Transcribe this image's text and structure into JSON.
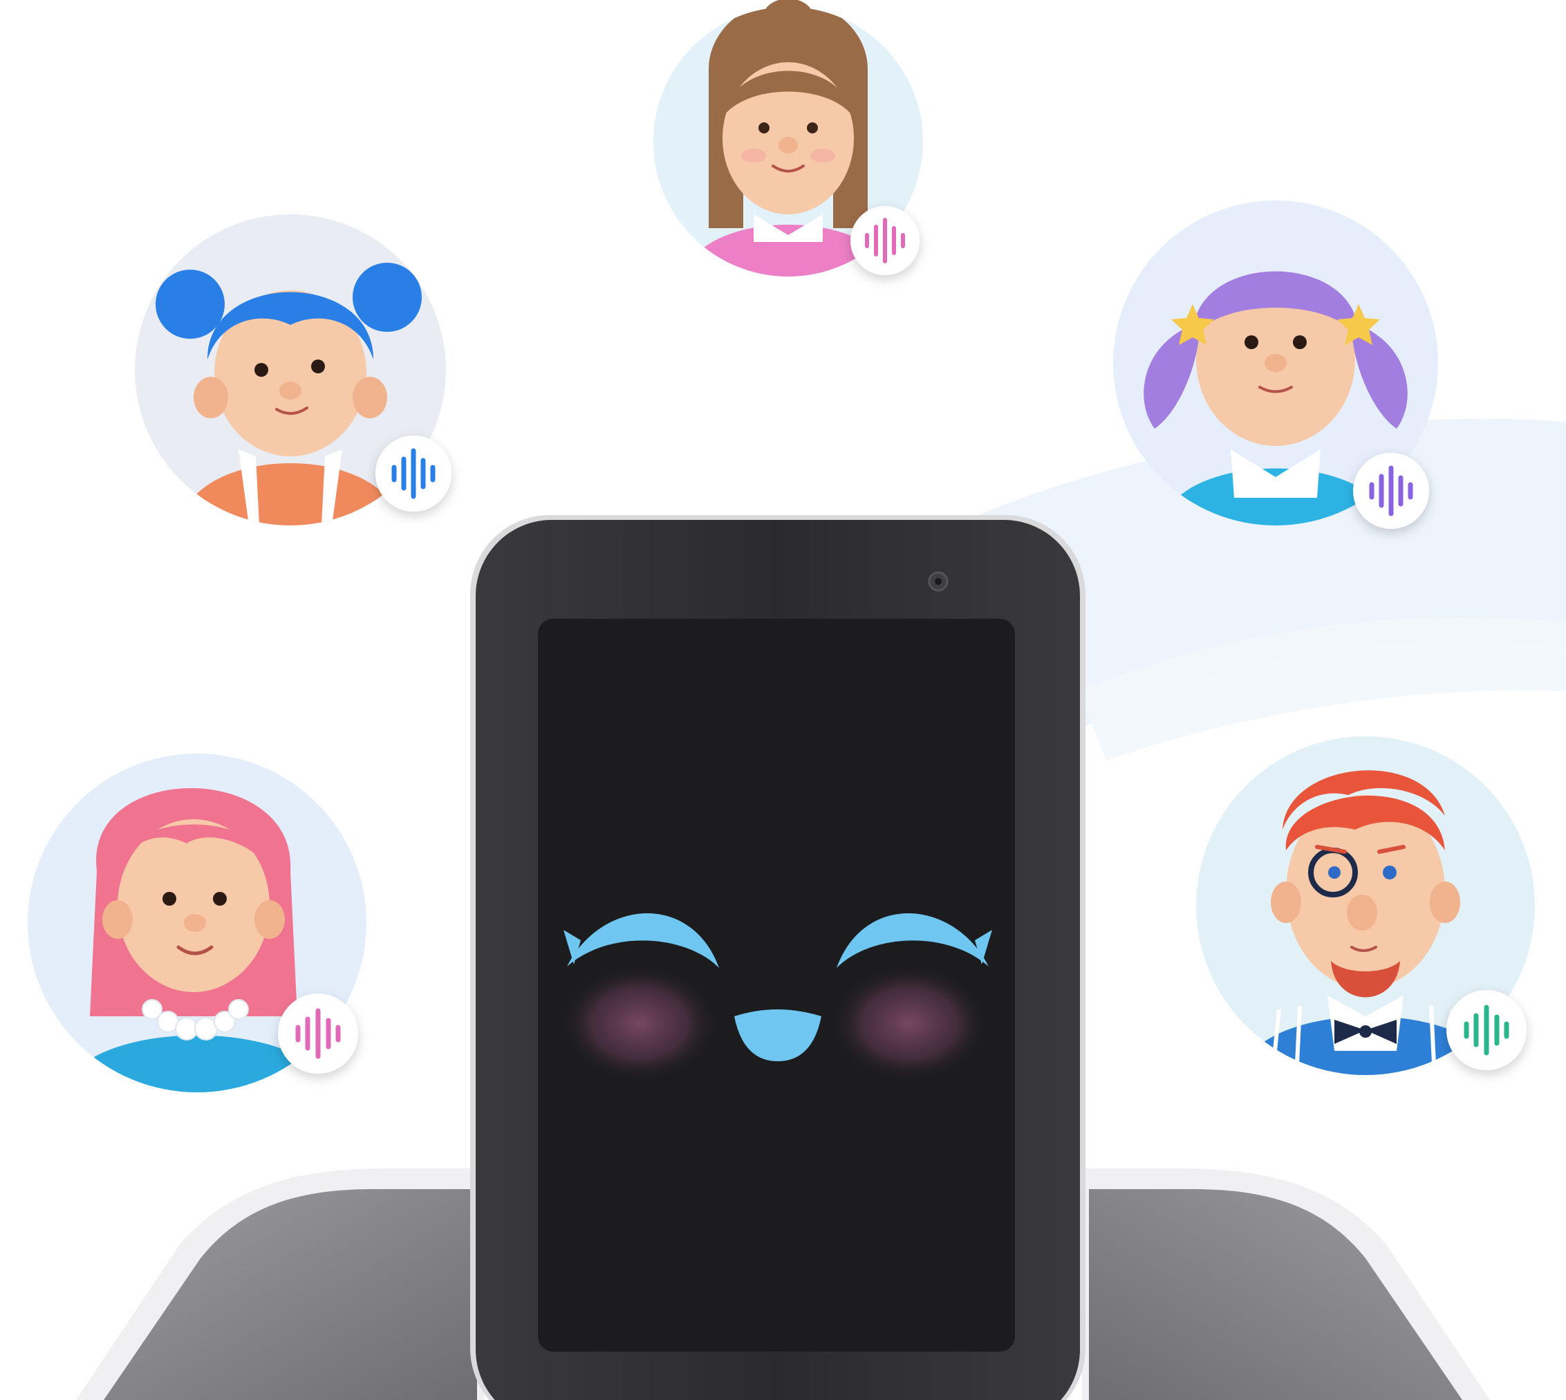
{
  "scene": {
    "background_color": "#ffffff",
    "swoosh_color": "#eaf2fb"
  },
  "device": {
    "body_color": "#2b2b2d",
    "screen_color": "#1c1c1e",
    "base_color": "#8e8e92",
    "face": {
      "eye_color": "#6fc6f0",
      "nose_color": "#6fc6f0",
      "blush_color": "#7d4a66",
      "expression": "happy-closed-eyes"
    }
  },
  "avatars": [
    {
      "id": "woman-brown-ponytail",
      "skin": "#f6c9a8",
      "hair": "#9a6b47",
      "outfit": "#ec7fc5",
      "bg": "#e3f1f9",
      "voice_color": "#e06bb8",
      "voice_icon": "voice-wave-icon"
    },
    {
      "id": "girl-blue-buns",
      "skin": "#f6c9a8",
      "hair": "#2a7fe6",
      "outfit": "#f08a5d",
      "bg": "#e9edf3",
      "voice_color": "#2a7fe6",
      "voice_icon": "voice-wave-icon"
    },
    {
      "id": "girl-purple-pigtails",
      "skin": "#f6c9a8",
      "hair": "#a27ee0",
      "outfit": "#2cb3e4",
      "bg": "#e6eefb",
      "voice_color": "#8a63e0",
      "voice_icon": "voice-wave-icon"
    },
    {
      "id": "woman-pink-hair-pearls",
      "skin": "#f6c9a8",
      "hair": "#f0748f",
      "outfit": "#2aa9de",
      "bg": "#e4eefb",
      "voice_color": "#e06bb8",
      "voice_icon": "voice-wave-icon"
    },
    {
      "id": "man-red-hair-monocle",
      "skin": "#f6c9a8",
      "hair": "#e8553a",
      "outfit": "#2e7fd6",
      "bg": "#e2f1f7",
      "voice_color": "#2bb58a",
      "voice_icon": "voice-wave-icon"
    }
  ]
}
